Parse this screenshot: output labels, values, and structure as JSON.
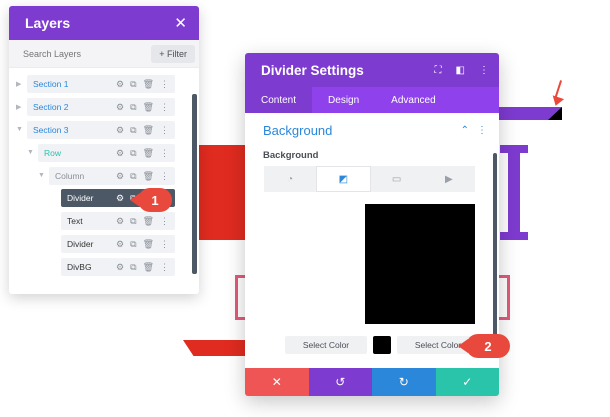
{
  "layers_panel": {
    "title": "Layers",
    "close_icon": "close-icon",
    "search_placeholder": "Search Layers",
    "filter_label": "+ Filter",
    "items": [
      {
        "label": "Section 1",
        "type": "section"
      },
      {
        "label": "Section 2",
        "type": "section"
      },
      {
        "label": "Section 3",
        "type": "section"
      },
      {
        "label": "Row",
        "type": "row"
      },
      {
        "label": "Column",
        "type": "column"
      },
      {
        "label": "Divider",
        "type": "module",
        "active": true
      },
      {
        "label": "Text",
        "type": "module"
      },
      {
        "label": "Divider",
        "type": "module"
      },
      {
        "label": "DivBG",
        "type": "module"
      }
    ]
  },
  "settings_modal": {
    "title": "Divider Settings",
    "tabs": [
      "Content",
      "Design",
      "Advanced"
    ],
    "active_tab": "Content",
    "section_title": "Background",
    "field_label": "Background",
    "background_types": [
      "color",
      "gradient",
      "image",
      "video"
    ],
    "active_background_type": "gradient",
    "select_color_left": "Select Color",
    "select_color_right": "Select Color",
    "swatch_color": "#000000",
    "footer": {
      "cancel_icon": "close-icon",
      "undo_icon": "undo-icon",
      "redo_icon": "redo-icon",
      "save_icon": "check-icon"
    }
  },
  "markers": {
    "first": "1",
    "second": "2"
  },
  "colors": {
    "purple": "#7e3bd0",
    "tab_purple": "#8f42ec",
    "red": "#ef5555",
    "blue": "#2b87da",
    "teal": "#29c4a9",
    "callout": "#e8493c"
  }
}
